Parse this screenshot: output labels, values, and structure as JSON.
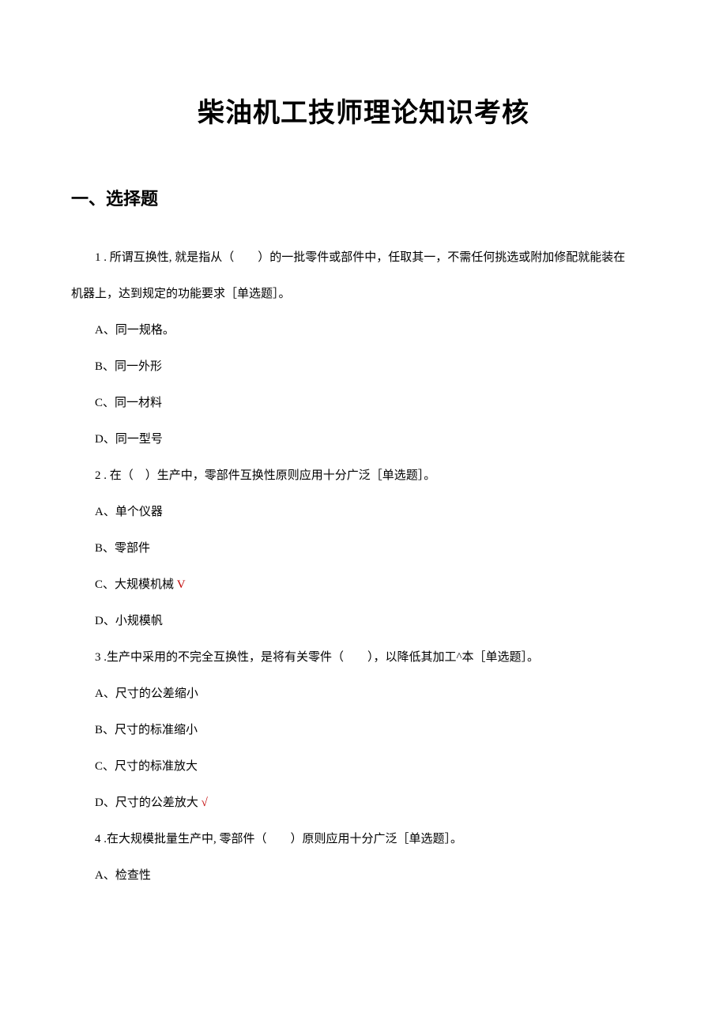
{
  "title": "柴油机工技师理论知识考核",
  "section": "一、选择题",
  "q1": {
    "line1": "1 . 所谓互换性, 就是指从（　　）的一批零件或部件中，任取其一，不需任何挑选或附加修配就能装在",
    "line2": "机器上，达到规定的功能要求［单选题］。",
    "a": "A、同一规格。",
    "b": "B、同一外形",
    "c": "C、同一材料",
    "d": "D、同一型号"
  },
  "q2": {
    "text": "2 . 在（　）生产中，零部件互换性原则应用十分广泛［单选题］。",
    "a": "A、单个仪器",
    "b": "B、零部件",
    "c_prefix": "C、大规模机械",
    "c_mark": " V",
    "d": "D、小规模帆"
  },
  "q3": {
    "text": "3 .生产中采用的不完全互换性，是将有关零件（　　），以降低其加工^本［单选题］。",
    "a": "A、尺寸的公差缩小",
    "b": "B、尺寸的标准缩小",
    "c": "C、尺寸的标准放大",
    "d_prefix": "D、尺寸的公差放大",
    "d_mark": " √"
  },
  "q4": {
    "text": "4 .在大规模批量生产中, 零部件（　　）原则应用十分广泛［单选题］。",
    "a": "A、检查性"
  }
}
